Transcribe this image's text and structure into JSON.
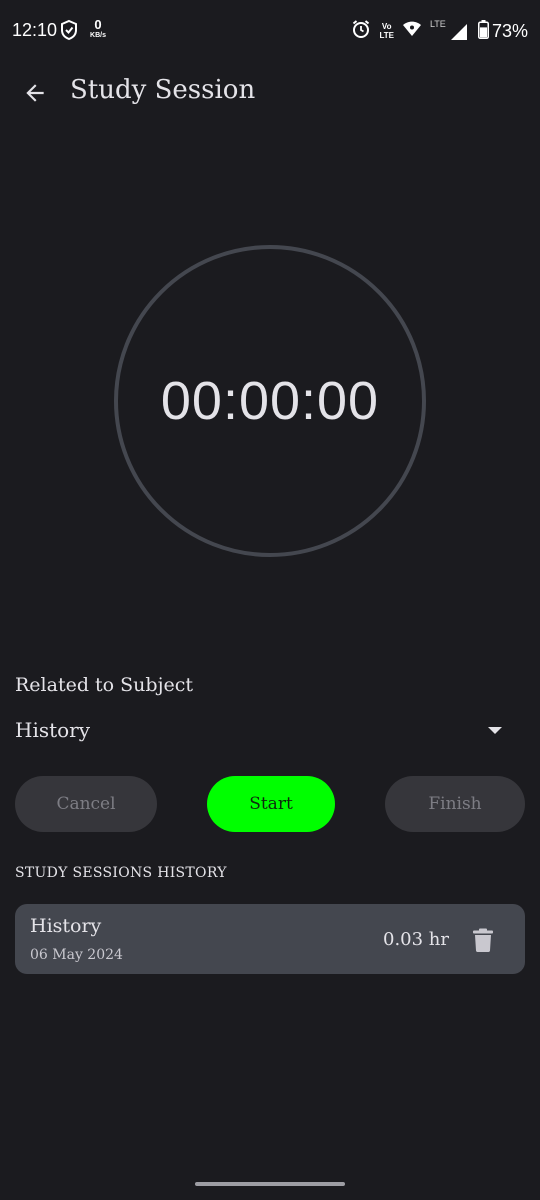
{
  "status_bar": {
    "time": "12:10",
    "net_speed_value": "0",
    "net_speed_unit": "KB/s",
    "volte_line1": "Vo",
    "volte_line2": "LTE",
    "network_type": "LTE",
    "battery": "73%",
    "battery_level": 0.73,
    "icons": [
      "shield-icon",
      "alarm-icon",
      "volte-icon",
      "wifi-icon",
      "signal-icon",
      "battery-icon"
    ]
  },
  "app_bar": {
    "title": "Study Session",
    "back_icon": "arrow-back-icon"
  },
  "timer": {
    "display": "00:00:00"
  },
  "subject": {
    "label": "Related to Subject",
    "selected": "History",
    "dropdown_icon": "triangle-down-icon"
  },
  "actions": {
    "cancel": "Cancel",
    "start": "Start",
    "finish": "Finish"
  },
  "history": {
    "heading": "STUDY SESSIONS HISTORY",
    "sessions": [
      {
        "subject": "History",
        "date": "06 May 2024",
        "duration": "0.03 hr",
        "action_icon": "delete-icon"
      }
    ]
  },
  "colors": {
    "background": "#1b1b1f",
    "start_button": "#00ff00",
    "card": "#44474f",
    "timer_ring": "#44474f",
    "disabled_button": "#36363b"
  }
}
